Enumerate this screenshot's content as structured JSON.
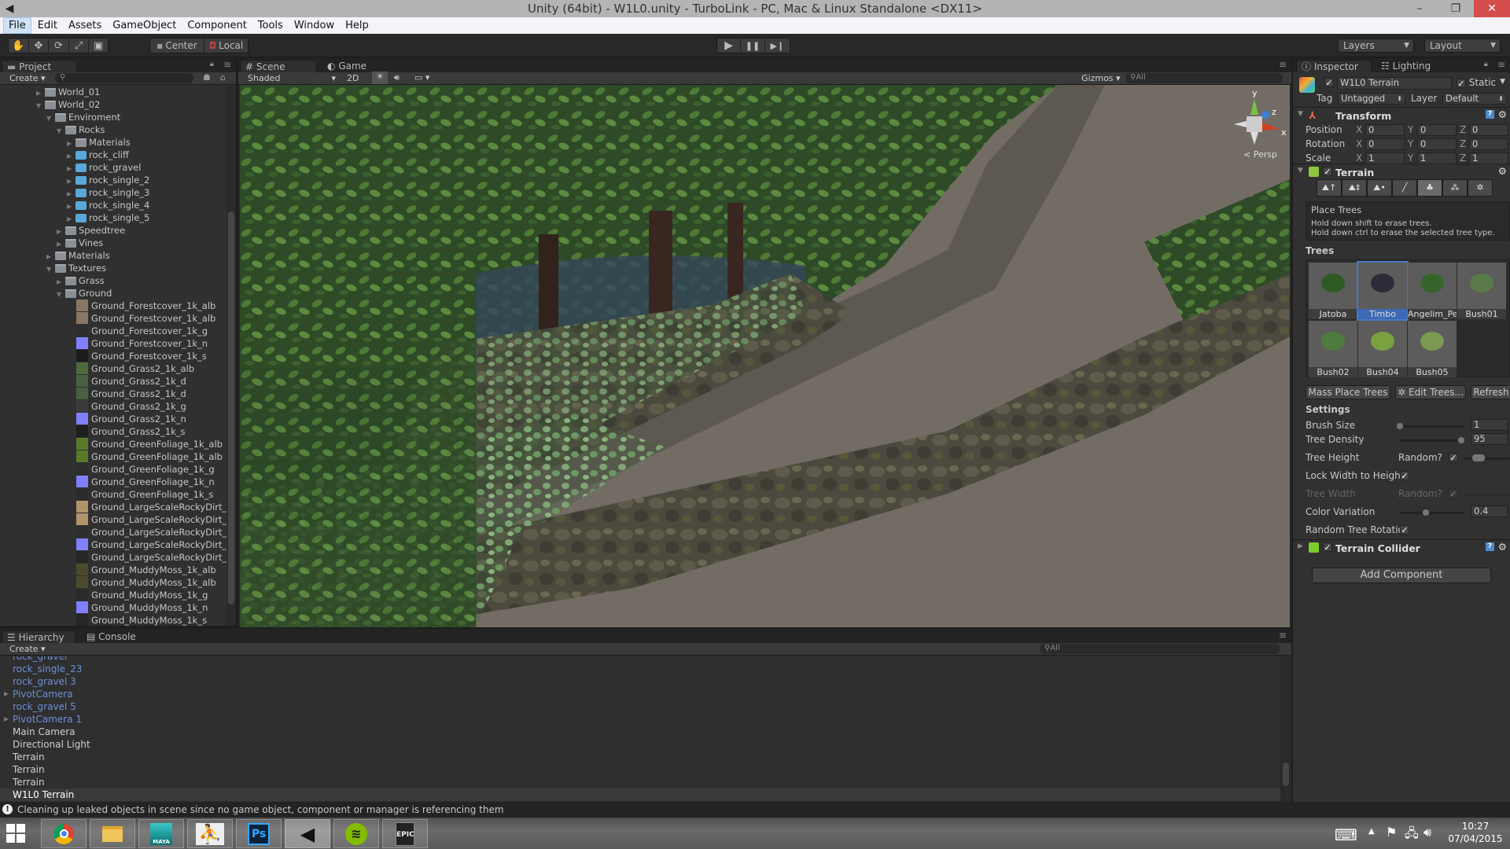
{
  "window": {
    "title": "Unity (64bit) - W1L0.unity - TurboLink - PC, Mac & Linux Standalone <DX11>",
    "controls": {
      "minimize": "–",
      "maximize": "❐",
      "close": "✕"
    }
  },
  "menu": [
    "File",
    "Edit",
    "Assets",
    "GameObject",
    "Component",
    "Tools",
    "Window",
    "Help"
  ],
  "toolbar": {
    "tools": [
      "hand-tool",
      "move-tool",
      "rotate-tool",
      "scale-tool",
      "rect-tool"
    ],
    "pivot_mode": "Center",
    "pivot_rotation": "Local",
    "play": "▶",
    "pause": "❚❚",
    "step": "▶❙",
    "layers": "Layers",
    "layout": "Layout"
  },
  "project": {
    "tab": "Project",
    "create": "Create",
    "search_placeholder": "",
    "tree": [
      {
        "label": "World_01",
        "depth": 0,
        "expanded": false,
        "type": "folder"
      },
      {
        "label": "World_02",
        "depth": 0,
        "expanded": true,
        "type": "folder"
      },
      {
        "label": "Enviroment",
        "depth": 1,
        "expanded": true,
        "type": "folder"
      },
      {
        "label": "Rocks",
        "depth": 2,
        "expanded": true,
        "type": "folder"
      },
      {
        "label": "Materials",
        "depth": 3,
        "expanded": false,
        "type": "folder"
      },
      {
        "label": "rock_cliff",
        "depth": 3,
        "expanded": false,
        "type": "mesh"
      },
      {
        "label": "rock_gravel",
        "depth": 3,
        "expanded": false,
        "type": "mesh"
      },
      {
        "label": "rock_single_2",
        "depth": 3,
        "expanded": false,
        "type": "mesh"
      },
      {
        "label": "rock_single_3",
        "depth": 3,
        "expanded": false,
        "type": "mesh"
      },
      {
        "label": "rock_single_4",
        "depth": 3,
        "expanded": false,
        "type": "mesh"
      },
      {
        "label": "rock_single_5",
        "depth": 3,
        "expanded": false,
        "type": "mesh"
      },
      {
        "label": "Speedtree",
        "depth": 2,
        "expanded": false,
        "type": "folder"
      },
      {
        "label": "Vines",
        "depth": 2,
        "expanded": false,
        "type": "folder"
      },
      {
        "label": "Materials",
        "depth": 1,
        "expanded": false,
        "type": "folder"
      },
      {
        "label": "Textures",
        "depth": 1,
        "expanded": true,
        "type": "folder"
      },
      {
        "label": "Grass",
        "depth": 2,
        "expanded": false,
        "type": "folder"
      },
      {
        "label": "Ground",
        "depth": 2,
        "expanded": true,
        "type": "folder"
      }
    ],
    "textures": [
      {
        "label": "Ground_Forestcover_1k_alb",
        "color": "#8a7763"
      },
      {
        "label": "Ground_Forestcover_1k_alb",
        "color": "#8a7763"
      },
      {
        "label": "Ground_Forestcover_1k_g",
        "color": "#2e2e2e"
      },
      {
        "label": "Ground_Forestcover_1k_n",
        "color": "#8080ff"
      },
      {
        "label": "Ground_Forestcover_1k_s",
        "color": "#1c1c1c"
      },
      {
        "label": "Ground_Grass2_1k_alb",
        "color": "#4e6a3c"
      },
      {
        "label": "Ground_Grass2_1k_d",
        "color": "#4a6040"
      },
      {
        "label": "Ground_Grass2_1k_d",
        "color": "#4a6040"
      },
      {
        "label": "Ground_Grass2_1k_g",
        "color": "#3b3b3b"
      },
      {
        "label": "Ground_Grass2_1k_n",
        "color": "#8080ff"
      },
      {
        "label": "Ground_Grass2_1k_s",
        "color": "#1d1f1d"
      },
      {
        "label": "Ground_GreenFoliage_1k_alb",
        "color": "#5a7a28"
      },
      {
        "label": "Ground_GreenFoliage_1k_alb",
        "color": "#5a7a28"
      },
      {
        "label": "Ground_GreenFoliage_1k_g",
        "color": "#2d2d2d"
      },
      {
        "label": "Ground_GreenFoliage_1k_n",
        "color": "#8080ff"
      },
      {
        "label": "Ground_GreenFoliage_1k_s",
        "color": "#2b2b2b"
      },
      {
        "label": "Ground_LargeScaleRockyDirt_",
        "color": "#b0936c"
      },
      {
        "label": "Ground_LargeScaleRockyDirt_",
        "color": "#b0936c"
      },
      {
        "label": "Ground_LargeScaleRockyDirt_",
        "color": "#2d2d2d"
      },
      {
        "label": "Ground_LargeScaleRockyDirt_",
        "color": "#8080ff"
      },
      {
        "label": "Ground_LargeScaleRockyDirt_",
        "color": "#262626"
      },
      {
        "label": "Ground_MuddyMoss_1k_alb",
        "color": "#4b4a2c"
      },
      {
        "label": "Ground_MuddyMoss_1k_alb",
        "color": "#4b4a2c"
      },
      {
        "label": "Ground_MuddyMoss_1k_g",
        "color": "#2a2a2a"
      },
      {
        "label": "Ground_MuddyMoss_1k_n",
        "color": "#8080ff"
      },
      {
        "label": "Ground_MuddyMoss_1k_s",
        "color": "#262626"
      }
    ]
  },
  "scene": {
    "tabs": [
      "Scene",
      "Game"
    ],
    "shading": "Shaded",
    "mode_2d": "2D",
    "gizmos": "Gizmos",
    "search_placeholder": "All",
    "gizmo_labels": {
      "y": "y",
      "z": "z",
      "x": "x"
    },
    "projection": "< Persp"
  },
  "hierarchy": {
    "tabs": [
      "Hierarchy",
      "Console"
    ],
    "create": "Create",
    "search_placeholder": "All",
    "items": [
      {
        "label": "rock_gravel",
        "prefab": true,
        "expandable": false
      },
      {
        "label": "rock_single_23",
        "prefab": true,
        "expandable": false
      },
      {
        "label": "rock_gravel 3",
        "prefab": true,
        "expandable": false
      },
      {
        "label": "PivotCamera",
        "prefab": true,
        "expandable": true
      },
      {
        "label": "rock_gravel 5",
        "prefab": true,
        "expandable": false
      },
      {
        "label": "PivotCamera 1",
        "prefab": true,
        "expandable": true
      },
      {
        "label": "Main Camera",
        "prefab": false,
        "expandable": false
      },
      {
        "label": "Directional Light",
        "prefab": false,
        "expandable": false
      },
      {
        "label": "Terrain",
        "prefab": false,
        "expandable": false
      },
      {
        "label": "Terrain",
        "prefab": false,
        "expandable": false
      },
      {
        "label": "Terrain",
        "prefab": false,
        "expandable": false
      },
      {
        "label": "W1L0 Terrain",
        "prefab": false,
        "expandable": false,
        "selected": true
      }
    ]
  },
  "inspector": {
    "tabs": [
      "Inspector",
      "Lighting"
    ],
    "object_name": "W1L0 Terrain",
    "active": true,
    "static_label": "Static",
    "static": true,
    "tag_label": "Tag",
    "tag": "Untagged",
    "layer_label": "Layer",
    "layer": "Default",
    "transform": {
      "title": "Transform",
      "rows": [
        {
          "label": "Position",
          "x": "0",
          "y": "0",
          "z": "0"
        },
        {
          "label": "Rotation",
          "x": "0",
          "y": "0",
          "z": "0"
        },
        {
          "label": "Scale",
          "x": "1",
          "y": "1",
          "z": "1"
        }
      ]
    },
    "terrain": {
      "title": "Terrain",
      "enabled": true,
      "tool_names": [
        "raise-lower-tool",
        "paint-height-tool",
        "smooth-height-tool",
        "paint-texture-tool",
        "place-trees-tool",
        "paint-details-tool",
        "terrain-settings-tool"
      ],
      "active_tool": 4,
      "help_title": "Place Trees",
      "help_line1": "Hold down shift to erase trees.",
      "help_line2": "Hold down ctrl to erase the selected tree type.",
      "trees_label": "Trees",
      "trees": [
        {
          "label": "Jatoba",
          "color": "#2f5a24",
          "selected": false
        },
        {
          "label": "Timbo",
          "color": "#2e2a3a",
          "selected": true
        },
        {
          "label": "Angelim_Pedra",
          "color": "#35652a",
          "selected": false
        },
        {
          "label": "Bush01",
          "color": "#5a7a4a",
          "selected": false
        },
        {
          "label": "Bush02",
          "color": "#4f7a3f",
          "selected": false
        },
        {
          "label": "Bush04",
          "color": "#7aa040",
          "selected": false
        },
        {
          "label": "Bush05",
          "color": "#7a9a50",
          "selected": false
        }
      ],
      "buttons": {
        "mass_place": "Mass Place Trees",
        "edit_trees": "✲ Edit Trees...",
        "refresh": "Refresh"
      },
      "settings_label": "Settings",
      "brush_size_label": "Brush Size",
      "brush_size": "1",
      "brush_size_fraction": 0.0,
      "tree_density_label": "Tree Density",
      "tree_density": "95",
      "tree_density_fraction": 0.95,
      "tree_height_label": "Tree Height",
      "random_label": "Random?",
      "tree_height_random": true,
      "lock_width_label": "Lock Width to Height",
      "lock_width": true,
      "tree_width_label": "Tree Width",
      "tree_width_random": true,
      "color_variation_label": "Color Variation",
      "color_variation": "0.4",
      "color_variation_fraction": 0.4,
      "random_rotation_label": "Random Tree Rotatio",
      "random_rotation": true
    },
    "terrain_collider": {
      "title": "Terrain Collider",
      "enabled": true
    },
    "add_component": "Add Component"
  },
  "status": {
    "message": "Cleaning up leaked objects in scene since no game object, component or manager is referencing them"
  },
  "taskbar": {
    "apps": [
      {
        "name": "chrome",
        "label": ""
      },
      {
        "name": "file-explorer",
        "label": ""
      },
      {
        "name": "maya",
        "label": "MAYA"
      },
      {
        "name": "zbrush",
        "label": ""
      },
      {
        "name": "photoshop",
        "label": "Ps"
      },
      {
        "name": "unity",
        "label": ""
      },
      {
        "name": "spotify",
        "label": ""
      },
      {
        "name": "epic-games",
        "label": "EPIC"
      }
    ],
    "time": "10:27",
    "date": "07/04/2015"
  }
}
